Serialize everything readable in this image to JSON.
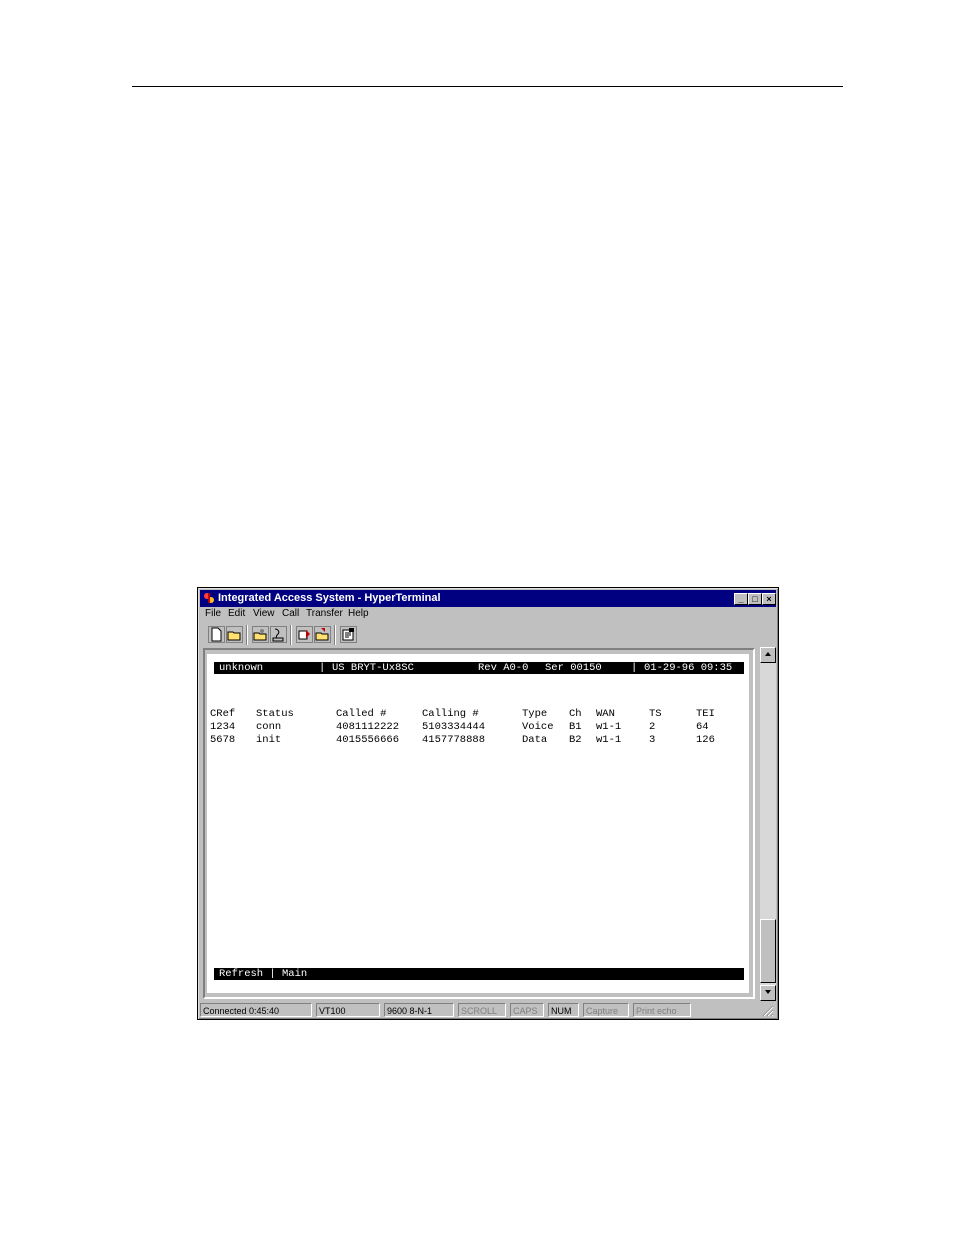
{
  "window": {
    "title": "Integrated Access System - HyperTerminal"
  },
  "menu": [
    "File",
    "Edit",
    "View",
    "Call",
    "Transfer",
    "Help"
  ],
  "toolbar_icons": [
    "new-icon",
    "open-icon",
    "connect-icon",
    "disconnect-icon",
    "send-icon",
    "receive-icon",
    "properties-icon"
  ],
  "terminal": {
    "header": {
      "host": "unknown",
      "model": "US  BRYT-Ux8SC",
      "rev": "Rev A0-0",
      "ser": "Ser 00150",
      "datetime": "01-29-96 09:35"
    },
    "columns": [
      "CRef",
      "Status",
      "Called #",
      "Calling #",
      "Type",
      "Ch",
      "WAN",
      "TS",
      "TEI"
    ],
    "rows": [
      [
        "1234",
        "conn",
        "4081112222",
        "5103334444",
        "Voice",
        "B1",
        "w1-1",
        "2",
        "64"
      ],
      [
        "5678",
        "init",
        "4015556666",
        "4157778888",
        "Data",
        "B2",
        "w1-1",
        "3",
        "126"
      ]
    ],
    "footer": "Refresh | Main"
  },
  "statusbar": {
    "connected": "Connected 0:45:40",
    "emulation": "VT100",
    "settings": "9600 8-N-1",
    "scroll": "SCROLL",
    "caps": "CAPS",
    "num": "NUM",
    "capture": "Capture",
    "print_echo": "Print echo"
  }
}
